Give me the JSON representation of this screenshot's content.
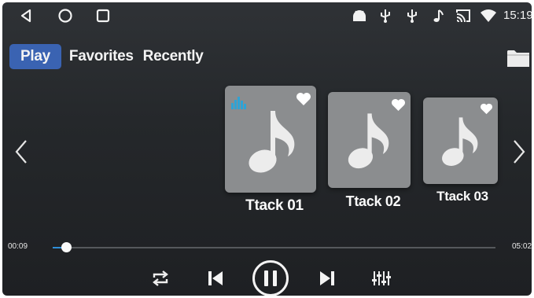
{
  "status": {
    "time": "15:19"
  },
  "tabs": [
    {
      "label": "Play",
      "active": true
    },
    {
      "label": "Favorites",
      "active": false
    },
    {
      "label": "Recently",
      "active": false
    }
  ],
  "tracks": [
    {
      "title": "Ttack 01",
      "playing": true,
      "favorite": true
    },
    {
      "title": "Ttack 02",
      "playing": false,
      "favorite": true
    },
    {
      "title": "Ttack 03",
      "playing": false,
      "favorite": true
    }
  ],
  "progress": {
    "elapsed": "00:09",
    "total": "05:02",
    "fraction": 0.03
  },
  "player": {
    "state": "playing"
  },
  "colors": {
    "accent": "#3a63b2",
    "equalizer": "#2ea3d6",
    "card": "#8b8d8f"
  },
  "icons": [
    "back-icon",
    "home-icon",
    "recents-icon",
    "android-icon",
    "usb-icon",
    "music-note-icon",
    "cast-icon",
    "wifi-icon",
    "folder-icon",
    "chevron-left-icon",
    "chevron-right-icon",
    "repeat-icon",
    "skip-previous-icon",
    "pause-icon",
    "skip-next-icon",
    "equalizer-settings-icon",
    "heart-icon"
  ]
}
